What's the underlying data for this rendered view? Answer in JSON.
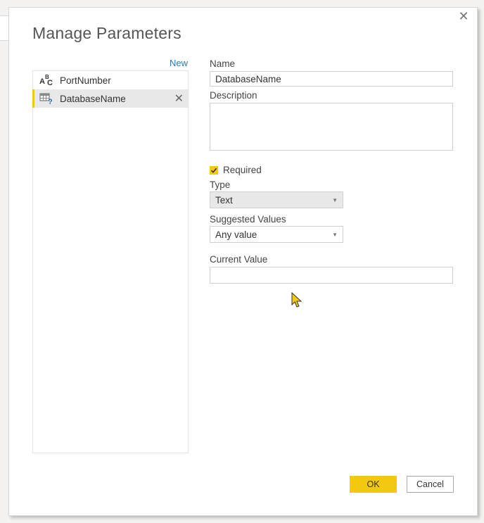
{
  "dialog": {
    "title": "Manage Parameters",
    "close_icon": "close-icon"
  },
  "parameters_list": {
    "new_label": "New",
    "items": [
      {
        "label": "PortNumber",
        "icon": "text-type-icon",
        "selected": false
      },
      {
        "label": "DatabaseName",
        "icon": "table-parameter-icon",
        "selected": true
      }
    ]
  },
  "form": {
    "name_label": "Name",
    "name_value": "DatabaseName",
    "description_label": "Description",
    "description_value": "",
    "required_label": "Required",
    "required_checked": true,
    "type_label": "Type",
    "type_value": "Text",
    "suggested_values_label": "Suggested Values",
    "suggested_values_value": "Any value",
    "current_value_label": "Current Value",
    "current_value_value": ""
  },
  "footer": {
    "ok_label": "OK",
    "cancel_label": "Cancel"
  },
  "colors": {
    "accent": "#f2c811",
    "link": "#2a7ab8"
  }
}
